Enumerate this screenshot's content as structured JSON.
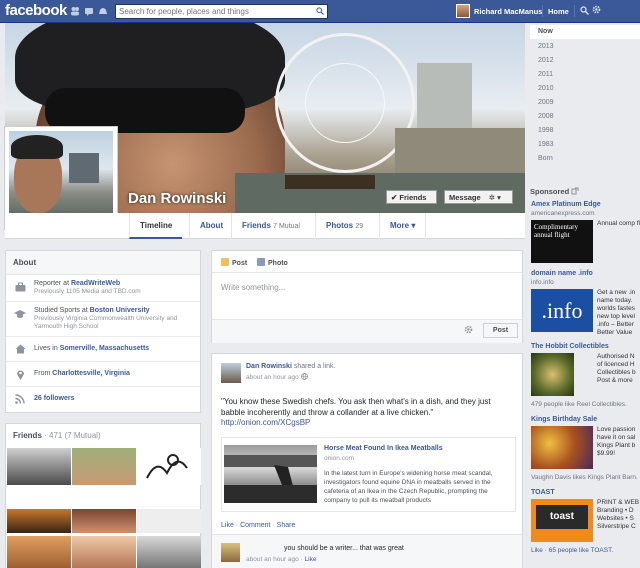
{
  "topbar": {
    "logo": "facebook",
    "search_placeholder": "Search for people, places and things",
    "user_name": "Richard MacManus",
    "home_label": "Home"
  },
  "cover": {
    "name": "Dan Rowinski",
    "friends_button": "✔ Friends",
    "message_button": "Message",
    "settings_glyph": "✲ ▾"
  },
  "tabs": {
    "timeline": "Timeline",
    "about": "About",
    "friends": "Friends",
    "friends_count": "7 Mutual",
    "photos": "Photos",
    "photos_count": "29",
    "more": "More ▾"
  },
  "about": {
    "title": "About",
    "rows": [
      {
        "icon": "briefcase-icon",
        "line1_prefix": "Reporter at ",
        "line1_link": "ReadWriteWeb",
        "line2": "Previously 1105 Media and TBD.com"
      },
      {
        "icon": "graduation-cap-icon",
        "line1_prefix": "Studied Sports at ",
        "line1_link": "Boston University",
        "line2": "Previously Virginia Commonwealth University and Yarmouth High School"
      },
      {
        "icon": "house-icon",
        "line1_prefix": "Lives in ",
        "line1_link": "Somerville, Massachusetts",
        "line2": ""
      },
      {
        "icon": "location-pin-icon",
        "line1_prefix": "From ",
        "line1_link": "Charlottesville, Virginia",
        "line2": ""
      },
      {
        "icon": "rss-icon",
        "line1_prefix": "",
        "line1_link": "26 followers",
        "line2": ""
      }
    ]
  },
  "friends_card": {
    "title": "Friends",
    "count": "· 471 (7 Mutual)"
  },
  "composer": {
    "post_tab": "Post",
    "photo_tab": "Photo",
    "placeholder": "Write something...",
    "post_button": "Post"
  },
  "story": {
    "author": "Dan Rowinski",
    "action": "shared a link.",
    "time": "about an hour ago",
    "message": "\"You know these Swedish chefs. You ask then what's in a dish, and they just babble incoherently and throw a collander at a live chicken.\"",
    "url": "http://onion.com/XCgsBP",
    "link_title": "Horse Meat Found In Ikea Meatballs",
    "link_domain": "onion.com",
    "link_desc": "In the latest turn in Europe's widening horse meat scandal, investigators found equine DNA in meatballs served in the cafeteria of an Ikea in the Czech Republic, prompting the company to pull its meatball products",
    "like": "Like",
    "comment": "Comment",
    "share": "Share",
    "separator": " · ",
    "comment_text": "you should be a writer... that was great",
    "comment_time": "about an hour ago",
    "comment_like": "Like"
  },
  "years": [
    "Now",
    "2013",
    "2012",
    "2011",
    "2010",
    "2009",
    "2008",
    "1998",
    "1983",
    "Born"
  ],
  "sponsored": {
    "label": "Sponsored",
    "ads": [
      {
        "title": "Amex Platinum Edge",
        "sub": "americanexpress.com",
        "img_text": "Complimentary annual flight",
        "text": "Annual comp flight plus tr insurance an more. Apply"
      },
      {
        "title": "domain name .info",
        "sub": "info.info",
        "img_text": ".info",
        "text": "Get a new .in name today. worlds fastes new top level .info – Better Better Value"
      },
      {
        "title": "The Hobbit Collectibles",
        "sub": "",
        "img_text": "",
        "text": "Authorised N of licenced H Collectibles b Post & more",
        "foot": "479 people like Reel Collectibles."
      },
      {
        "title": "Kings Birthday Sale",
        "sub": "",
        "img_text": "",
        "text": "Love passion have it on sal Kings Plant b $9.99!",
        "foot": "Vaughn Davis likes Kings Plant Barn."
      },
      {
        "title": "TOAST",
        "sub": "",
        "img_text": "toast",
        "text": "PRINT & WEB Branding • D Websites • S Silverstripe C",
        "foot": "Like · 65 people like TOAST."
      }
    ]
  },
  "colors": {
    "brand_blue": "#3b5998",
    "page_bg": "#e9ebee"
  }
}
